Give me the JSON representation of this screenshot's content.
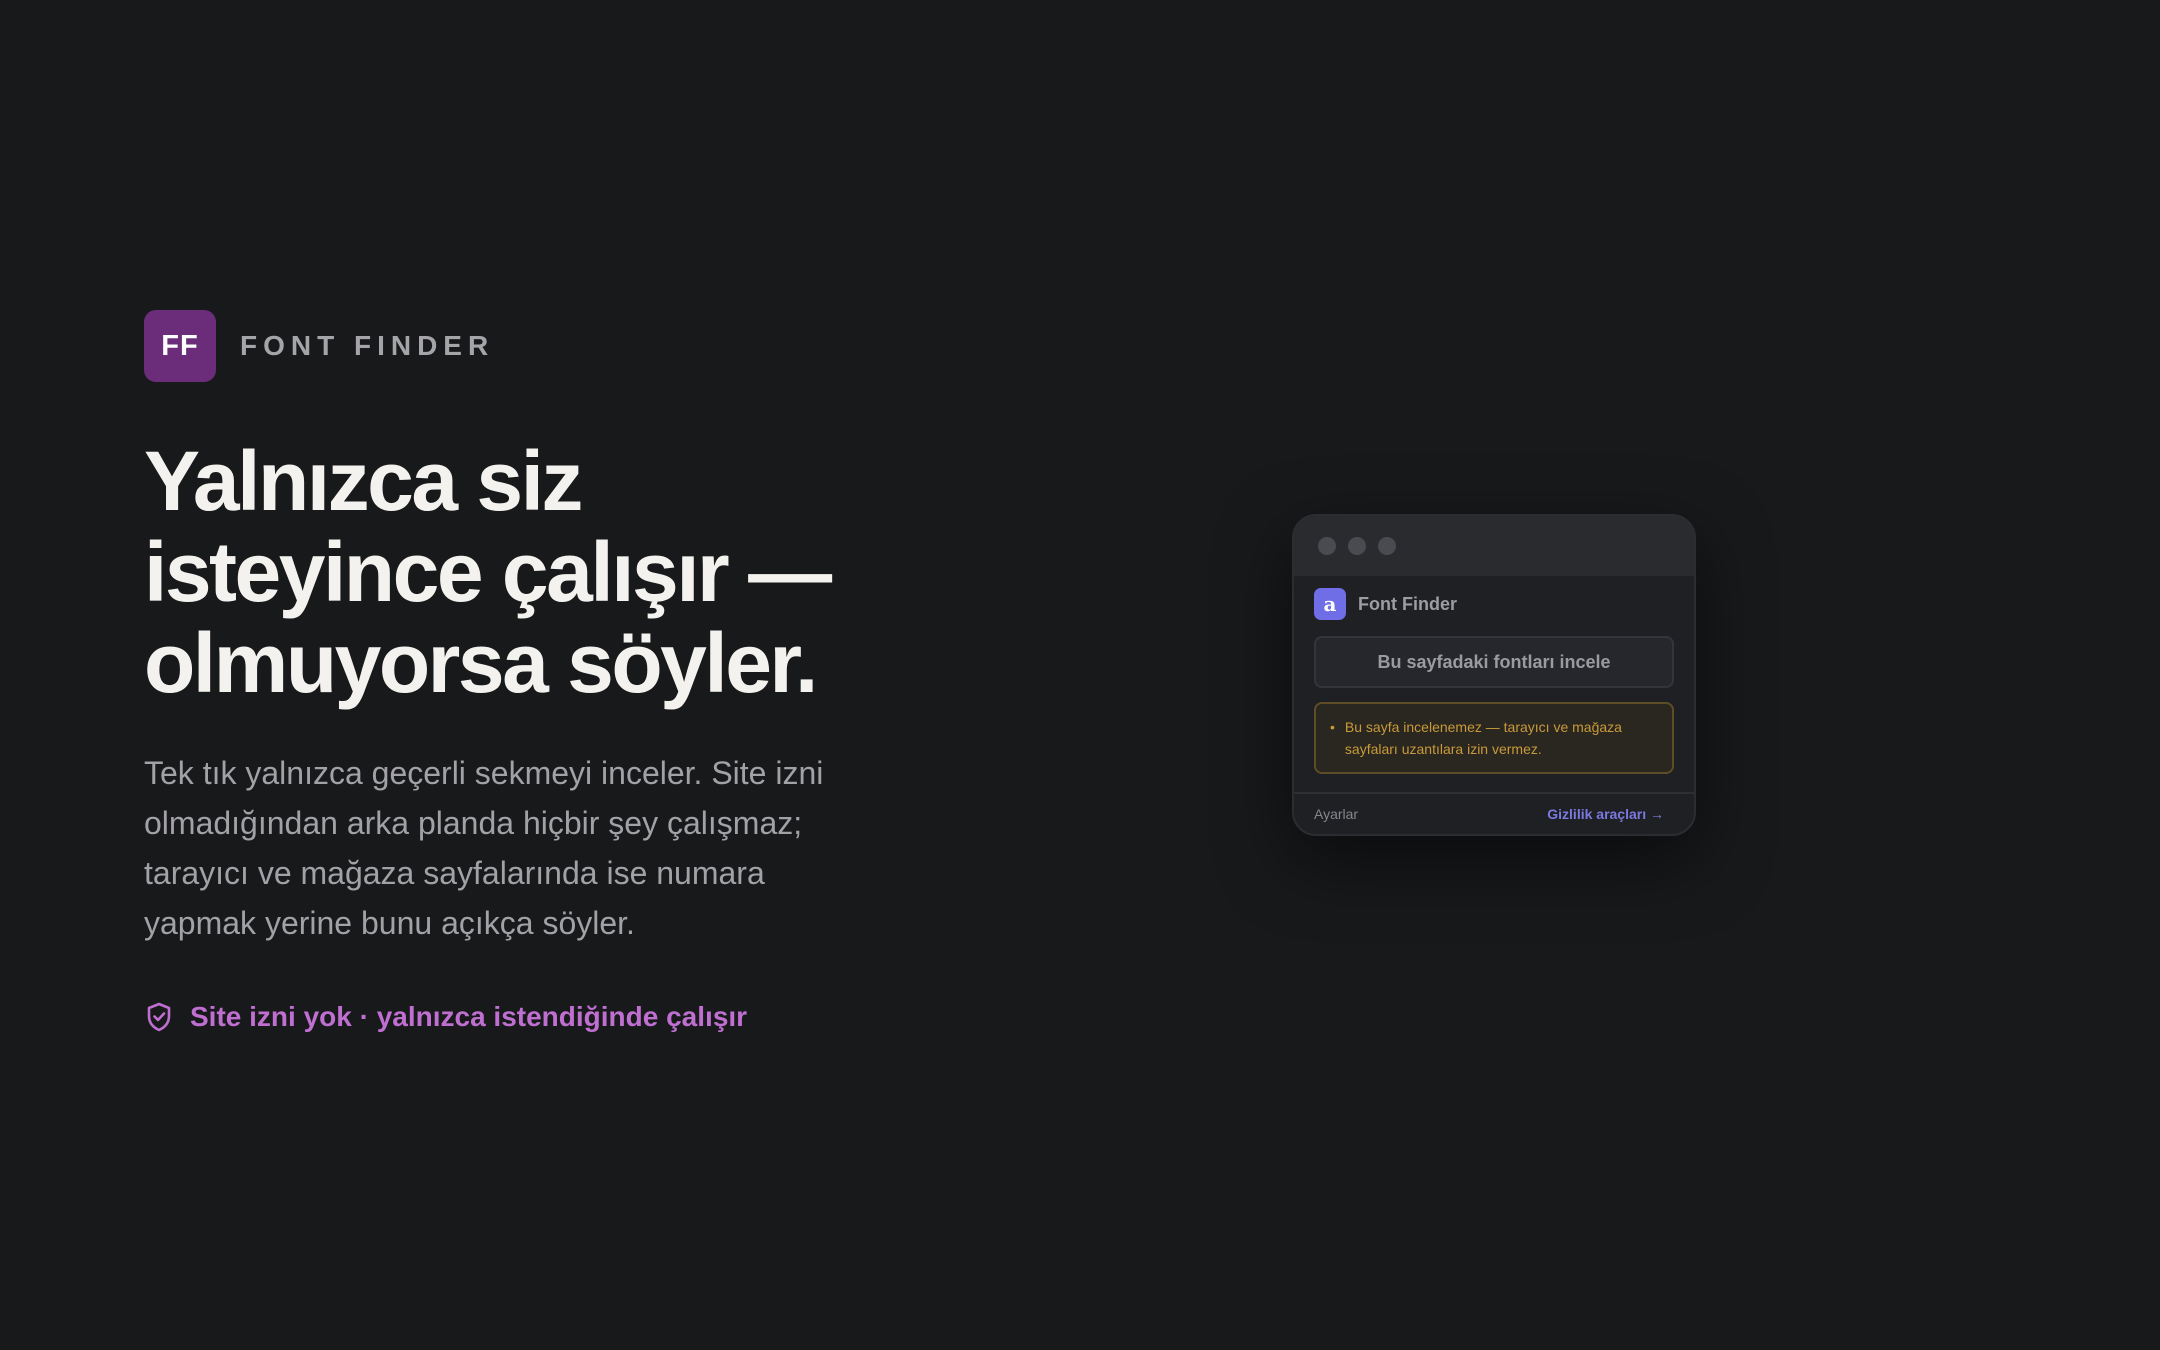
{
  "brand": {
    "logo_text": "FF",
    "name": "FONT FINDER"
  },
  "hero": {
    "headline_line1": "Yalnızca siz",
    "headline_line2": "isteyince çalışır —",
    "headline_line3": "olmuyorsa söyler.",
    "body": "Tek tık yalnızca geçerli sekmeyi inceler. Site izni olmadığından arka planda hiçbir şey çalışmaz; tarayıcı ve mağaza sayfalarında ise numara yapmak yerine bunu açıkça söyler."
  },
  "badge": {
    "icon": "shield-check-icon",
    "text": "Site izni yok · yalnızca istendiğinde çalışır"
  },
  "popup": {
    "app_icon_glyph": "a",
    "app_name": "Font Finder",
    "inspect_button_label": "Bu sayfadaki fontları incele",
    "warning_bullet": "•",
    "warning_text": "Bu sayfa incelenemez — tarayıcı ve mağaza sayfaları uzantılara izin vermez.",
    "footer_settings": "Ayarlar",
    "footer_link": "Gizlilik araçları →"
  },
  "colors": {
    "background": "#18191b",
    "brand_purple": "#6b2d7a",
    "accent_pink": "#be6fd0",
    "app_indigo": "#6f6ee6",
    "warning_amber": "#c89a3a"
  }
}
